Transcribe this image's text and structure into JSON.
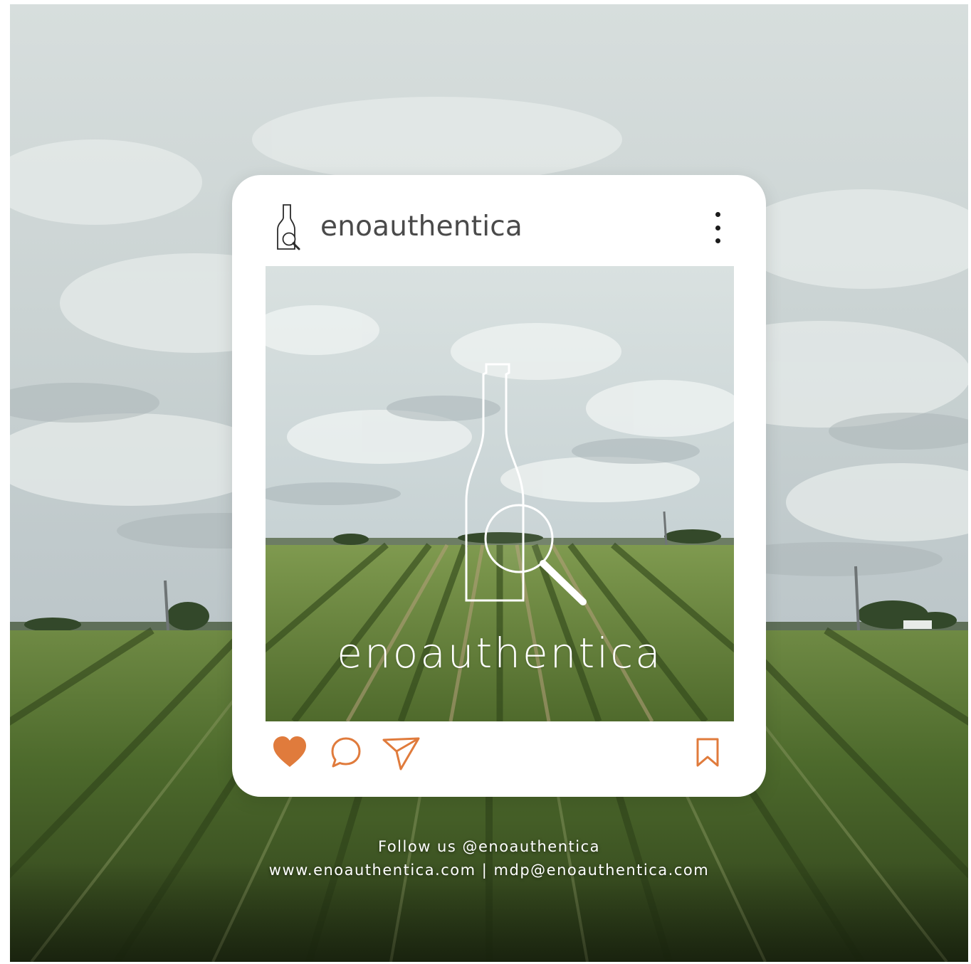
{
  "post": {
    "username": "enoauthentica",
    "image_brand_text": "enoauthentica",
    "avatar_icon": "wine-bottle-magnifier-icon",
    "menu_icon": "more-vertical-icon"
  },
  "actions": {
    "like_icon": "heart-icon",
    "comment_icon": "comment-icon",
    "share_icon": "send-icon",
    "save_icon": "bookmark-icon",
    "accent_color": "#e07b3c"
  },
  "footer": {
    "follow_text": "Follow us @enoauthentica",
    "contact_text": "www.enoauthentica.com | mdp@enoauthentica.com"
  },
  "colors": {
    "card_background": "#ffffff",
    "username_text": "#4a4a4a",
    "footer_text": "#ffffff"
  }
}
